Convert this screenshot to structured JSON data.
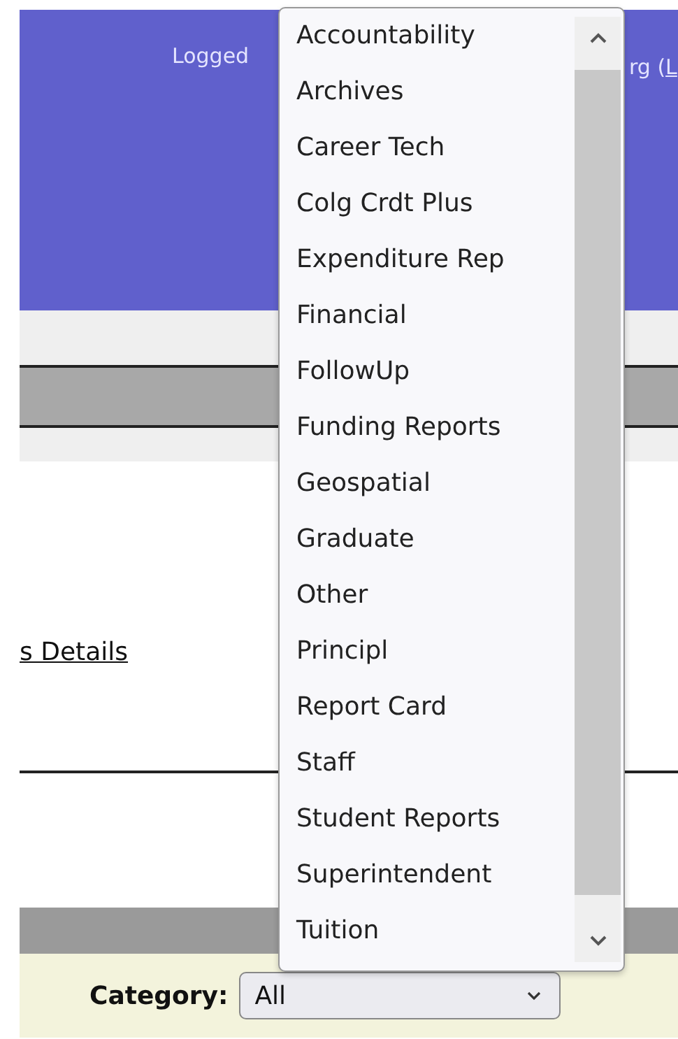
{
  "header": {
    "login_text_left": "Logged",
    "login_text_right": "rg (",
    "login_link": "L"
  },
  "details_link": "s Details",
  "filter": {
    "label": "Category:",
    "value": "All"
  },
  "dropdown": {
    "options": [
      "Accountability",
      "Archives",
      "Career Tech",
      "Colg Crdt Plus",
      "Expenditure Rep",
      "Financial",
      "FollowUp",
      "Funding Reports",
      "Geospatial",
      "Graduate",
      "Other",
      "Principl",
      "Report Card",
      "Staff",
      "Student Reports",
      "Superintendent",
      "Tuition"
    ]
  }
}
